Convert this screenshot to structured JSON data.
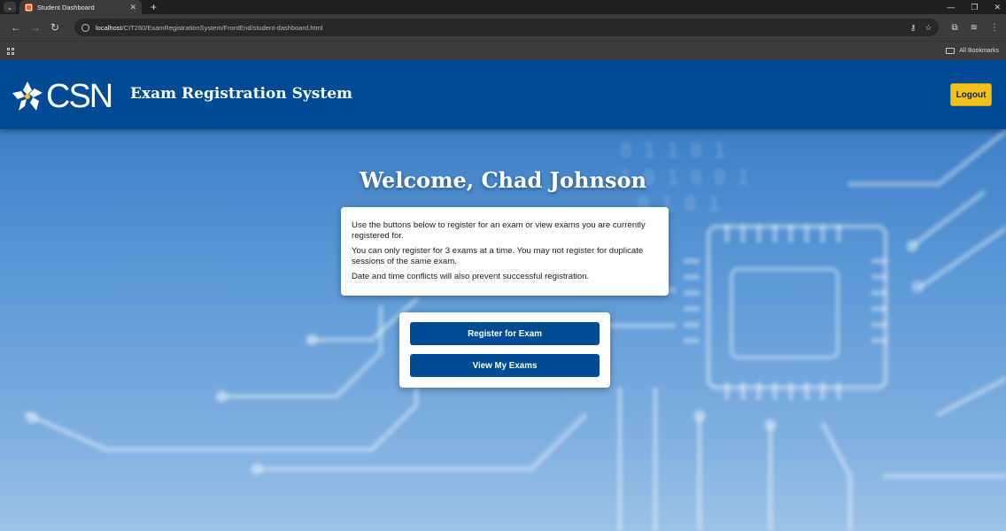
{
  "browser": {
    "tab_title": "Student Dashboard",
    "tab_close": "✕",
    "new_tab": "+",
    "url_host": "localhost",
    "url_path": "/CIT260/ExamRegistrationSystem/FrontEnd/student-dashboard.html",
    "all_bookmarks": "All Bookmarks"
  },
  "header": {
    "logo_text": "CSN",
    "title": "Exam Registration System",
    "logout_label": "Logout"
  },
  "main": {
    "welcome": "Welcome, Chad Johnson",
    "info": [
      "Use the buttons below to register for an exam or view exams you are currently registered for.",
      "You can only register for 3 exams at a time. You may not register for duplicate sessions of the same exam.",
      "Date and time conflicts will also prevent successful registration."
    ],
    "register_label": "Register for Exam",
    "view_label": "View My Exams"
  },
  "colors": {
    "header_bg": "#004b94",
    "accent_button": "#f2c21a",
    "primary_button": "#004b94"
  }
}
